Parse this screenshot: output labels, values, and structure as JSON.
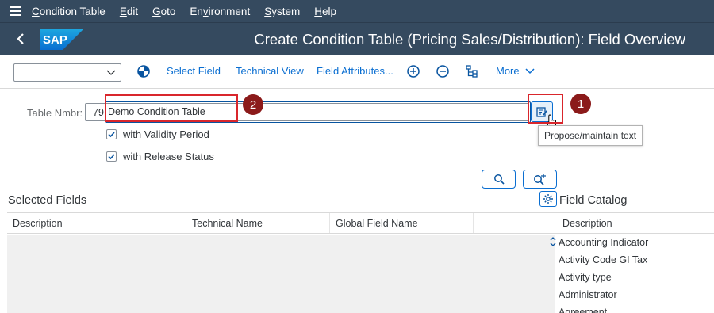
{
  "menu": {
    "items": [
      "Condition Table",
      "Edit",
      "Goto",
      "Environment",
      "System",
      "Help"
    ]
  },
  "header": {
    "title": "Create Condition Table (Pricing Sales/Distribution): Field Overview",
    "logo_text": "SAP"
  },
  "toolbar": {
    "select_value": "",
    "select_field": "Select Field",
    "technical_view": "Technical View",
    "field_attributes": "Field Attributes...",
    "more": "More"
  },
  "form": {
    "table_nmbr_label": "Table Nmbr:",
    "table_nmbr_prefix": "79",
    "table_nmbr_text": "Demo Condition Table",
    "with_validity_period": "with Validity Period",
    "with_validity_period_checked": true,
    "with_release_status": "with Release Status",
    "with_release_status_checked": true
  },
  "tooltip": "Propose/maintain text",
  "markers": [
    "1",
    "2"
  ],
  "selected_fields": {
    "title": "Selected Fields",
    "columns": [
      "Description",
      "Technical Name",
      "Global Field Name",
      ""
    ]
  },
  "field_catalog": {
    "title": "Field Catalog",
    "column": "Description",
    "items": [
      "Accounting Indicator",
      "Activity Code GI Tax",
      "Activity type",
      "Administrator",
      "Agreement"
    ]
  },
  "colors": {
    "shell": "#354a5f",
    "link": "#0a6ed1",
    "highlight": "#d9262c",
    "marker": "#8b1a1a"
  }
}
